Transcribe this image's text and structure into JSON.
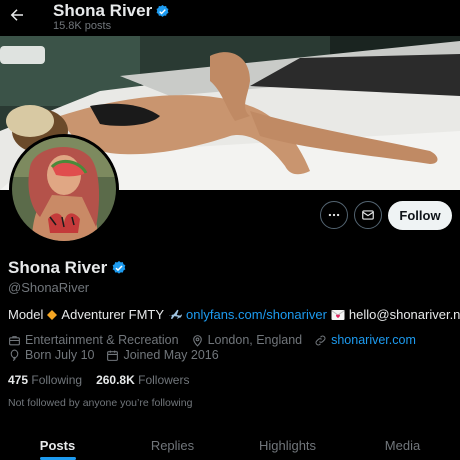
{
  "header": {
    "name": "Shona River",
    "posts_count": "15.8K posts"
  },
  "profile": {
    "name": "Shona River",
    "handle": "@ShonaRiver",
    "bio": {
      "prefix": "Model",
      "adventurer": "Adventurer FMTY",
      "link": "onlyfans.com/shonariver",
      "email": "hello@shonariver.net"
    },
    "category": "Entertainment & Recreation",
    "location": "London, England",
    "website": "shonariver.com",
    "born": "Born July 10",
    "joined": "Joined May 2016",
    "following_count": "475",
    "following_label": "Following",
    "followers_count": "260.8K",
    "followers_label": "Followers",
    "not_followed": "Not followed by anyone you’re following"
  },
  "actions": {
    "follow_label": "Follow"
  },
  "tabs": [
    {
      "label": "Posts"
    },
    {
      "label": "Replies"
    },
    {
      "label": "Highlights"
    },
    {
      "label": "Media"
    }
  ],
  "colors": {
    "accent": "#1d9bf0",
    "verified": "#1d9bf0"
  }
}
